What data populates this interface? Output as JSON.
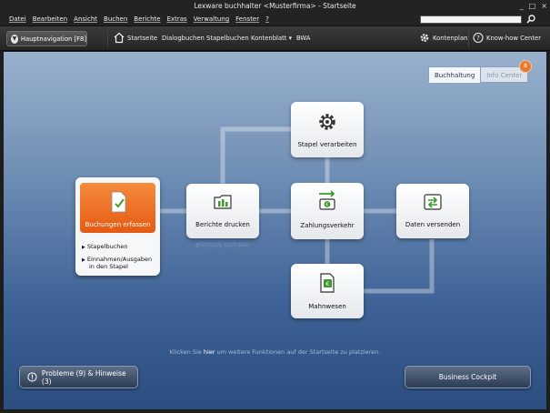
{
  "window": {
    "title": "Lexware buchhalter          <Musterfirma> - Startseite",
    "controls": [
      "_",
      "□",
      "×"
    ]
  },
  "menu": [
    "Datei",
    "Bearbeiten",
    "Ansicht",
    "Buchen",
    "Berichte",
    "Extras",
    "Verwaltung",
    "Fenster",
    "?"
  ],
  "search": {
    "value": ""
  },
  "toolbar": {
    "hauptnav": "Hauptnavigation [F8]",
    "startseite": "Startseite",
    "dialogbuchen": "Dialogbuchen",
    "stapelbuchen": "Stapelbuchen",
    "kontenblatt": "Kontenblatt ▾",
    "bwa": "BWA",
    "kontenplan": "Kontenplan",
    "knowhow": "Know-how Center"
  },
  "tabs": {
    "buchhaltung": "Buchhaltung",
    "info_center": "Info Center",
    "badge": "8"
  },
  "tiles": {
    "buchungen": "Buchungen erfassen",
    "sub1": "Stapelbuchen",
    "sub2a": "Einnahmen/Ausgaben",
    "sub2b": "in den Stapel",
    "berichte": "Berichte drucken",
    "stapel": "Stapel verarbeiten",
    "zahlung": "Zahlungsverkehr",
    "daten": "Daten versenden",
    "mahn": "Mahnwesen"
  },
  "hint": {
    "pre": "Klicken Sie ",
    "link": "hier",
    "post": " um weitere Funktionen auf der Startseite zu platzieren."
  },
  "bottom": {
    "probleme": "Probleme (9) & Hinweise (3)",
    "cockpit": "Business Cockpit"
  },
  "colors": {
    "accent": "#e55a12",
    "bg_top": "#9ab1cd",
    "bg_bottom": "#2b4d80"
  }
}
